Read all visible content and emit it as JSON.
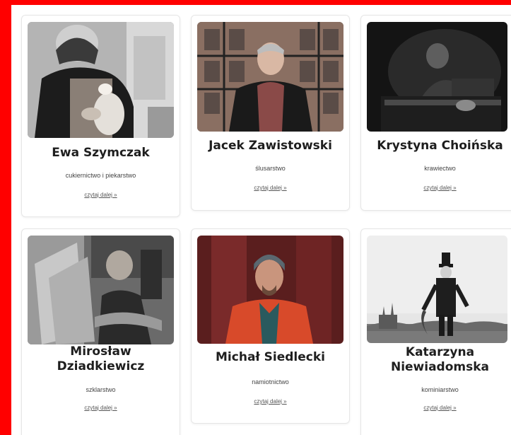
{
  "colors": {
    "frame": "#ff0000",
    "page": "#ffffff",
    "card_border": "#e6e6e6",
    "name_text": "#1e1e1e"
  },
  "people": [
    {
      "name": "Ewa Szymczak",
      "craft": "cukiernictwo i piekarstwo",
      "link": "czytaj dalej »",
      "photo": "baker-portrait"
    },
    {
      "name": "Jacek Zawistowski",
      "craft": "ślusarstwo",
      "link": "czytaj dalej »",
      "photo": "locksmith-portrait"
    },
    {
      "name": "Krystyna Choińska",
      "craft": "krawiectwo",
      "link": "czytaj dalej »",
      "photo": "tailor-portrait"
    },
    {
      "name": "Mirosław Dziadkiewicz",
      "craft": "szklarstwo",
      "link": "czytaj dalej »",
      "photo": "glazier-portrait"
    },
    {
      "name": "Michał Siedlecki",
      "craft": "namiotnictwo",
      "link": "czytaj dalej »",
      "photo": "tent-maker-portrait"
    },
    {
      "name": "Katarzyna Niewiadomska",
      "craft": "kominiarstwo",
      "link": "czytaj dalej »",
      "photo": "chimney-sweep-portrait"
    }
  ]
}
